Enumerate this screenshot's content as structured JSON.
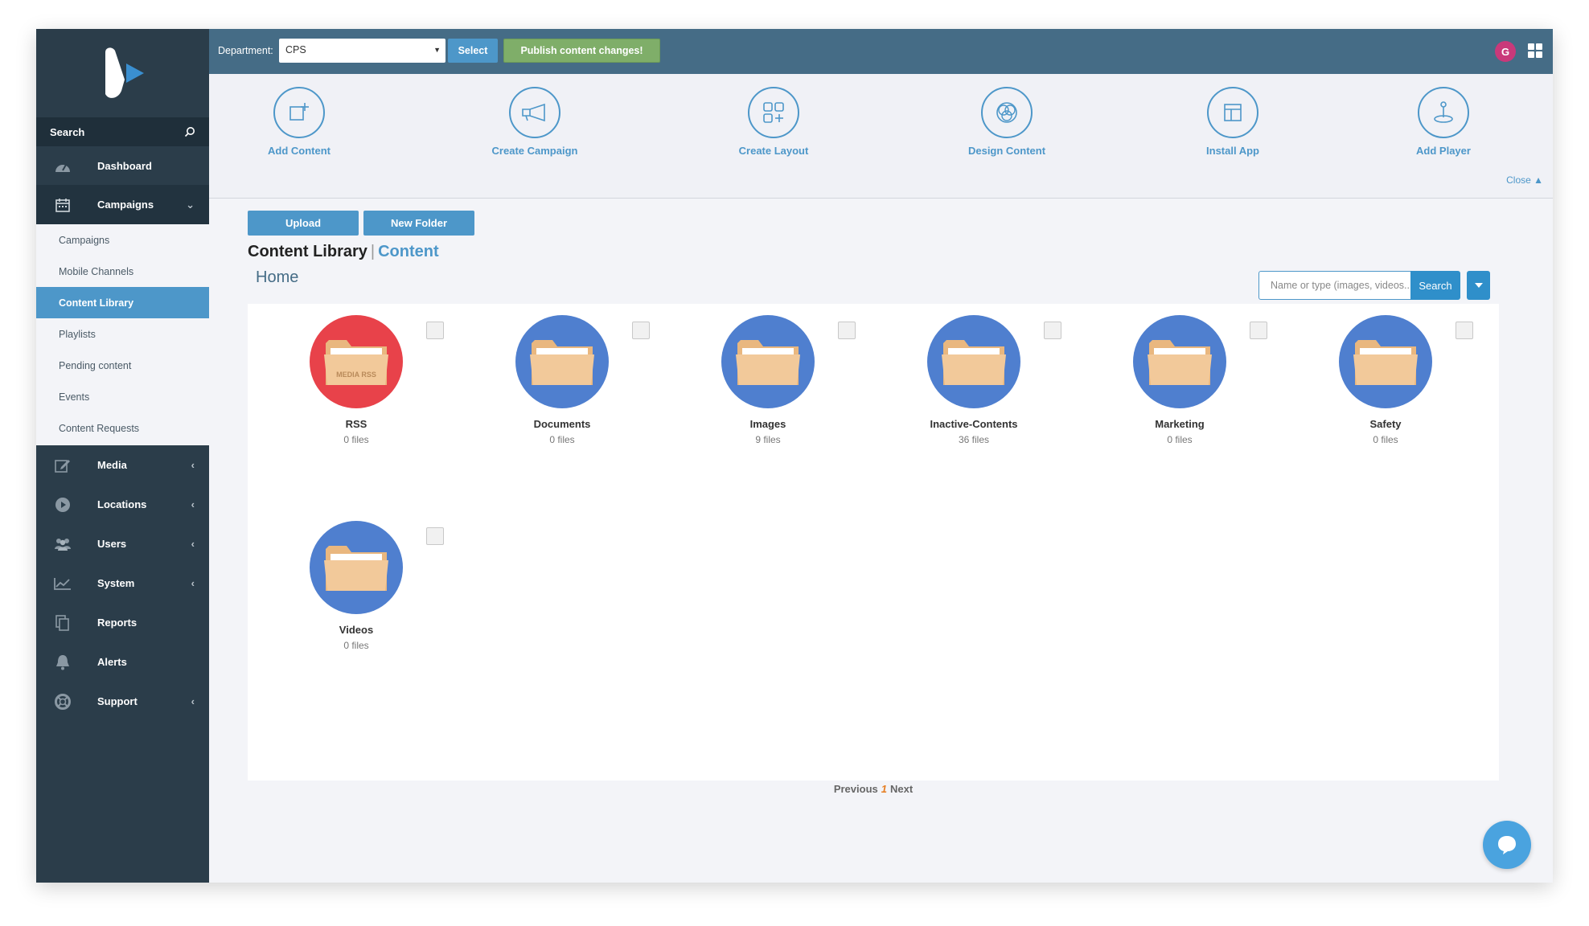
{
  "sidebar": {
    "search_label": "Search",
    "nav": [
      {
        "label": "Dashboard",
        "icon": "dashboard-icon"
      },
      {
        "label": "Campaigns",
        "icon": "calendar-icon"
      },
      {
        "label": "Media",
        "icon": "edit-icon"
      },
      {
        "label": "Locations",
        "icon": "play-icon"
      },
      {
        "label": "Users",
        "icon": "users-icon"
      },
      {
        "label": "System",
        "icon": "chart-icon"
      },
      {
        "label": "Reports",
        "icon": "copy-icon"
      },
      {
        "label": "Alerts",
        "icon": "bell-icon"
      },
      {
        "label": "Support",
        "icon": "lifebuoy-icon"
      }
    ],
    "sub": [
      {
        "label": "Campaigns"
      },
      {
        "label": "Mobile Channels"
      },
      {
        "label": "Content Library"
      },
      {
        "label": "Playlists"
      },
      {
        "label": "Pending content"
      },
      {
        "label": "Events"
      },
      {
        "label": "Content Requests"
      }
    ]
  },
  "topbar": {
    "department_label": "Department:",
    "department_value": "CPS",
    "select_label": "Select",
    "publish_label": "Publish content changes!",
    "avatar_initial": "G"
  },
  "quick_actions": [
    {
      "label": "Add Content",
      "icon": "add-content-icon"
    },
    {
      "label": "Create Campaign",
      "icon": "megaphone-icon"
    },
    {
      "label": "Create Layout",
      "icon": "layout-grid-icon"
    },
    {
      "label": "Design Content",
      "icon": "design-circles-icon"
    },
    {
      "label": "Install App",
      "icon": "app-window-icon"
    },
    {
      "label": "Add Player",
      "icon": "joystick-icon"
    }
  ],
  "close_label": "Close ▲",
  "main": {
    "upload_label": "Upload",
    "new_folder_label": "New Folder",
    "title": "Content Library",
    "title_sep": "|",
    "title_sub": "Content",
    "home_label": "Home",
    "search_placeholder": "Name or type (images, videos...)",
    "search_button": "Search"
  },
  "folders": [
    {
      "name": "RSS",
      "count": "0 files",
      "color": "#e8424a",
      "badge": "MEDIA RSS"
    },
    {
      "name": "Documents",
      "count": "0 files",
      "color": "#4f7fcf"
    },
    {
      "name": "Images",
      "count": "9 files",
      "color": "#4f7fcf"
    },
    {
      "name": "Inactive-Contents",
      "count": "36 files",
      "color": "#4f7fcf"
    },
    {
      "name": "Marketing",
      "count": "0 files",
      "color": "#4f7fcf"
    },
    {
      "name": "Safety",
      "count": "0 files",
      "color": "#4f7fcf"
    },
    {
      "name": "Videos",
      "count": "0 files",
      "color": "#4f7fcf"
    }
  ],
  "pager": {
    "previous": "Previous",
    "current": "1",
    "next": "Next"
  },
  "colors": {
    "sidebar": "#2b3d4a",
    "topbar": "#456c86",
    "accent": "#4d97c9",
    "publish": "#7fae69"
  }
}
